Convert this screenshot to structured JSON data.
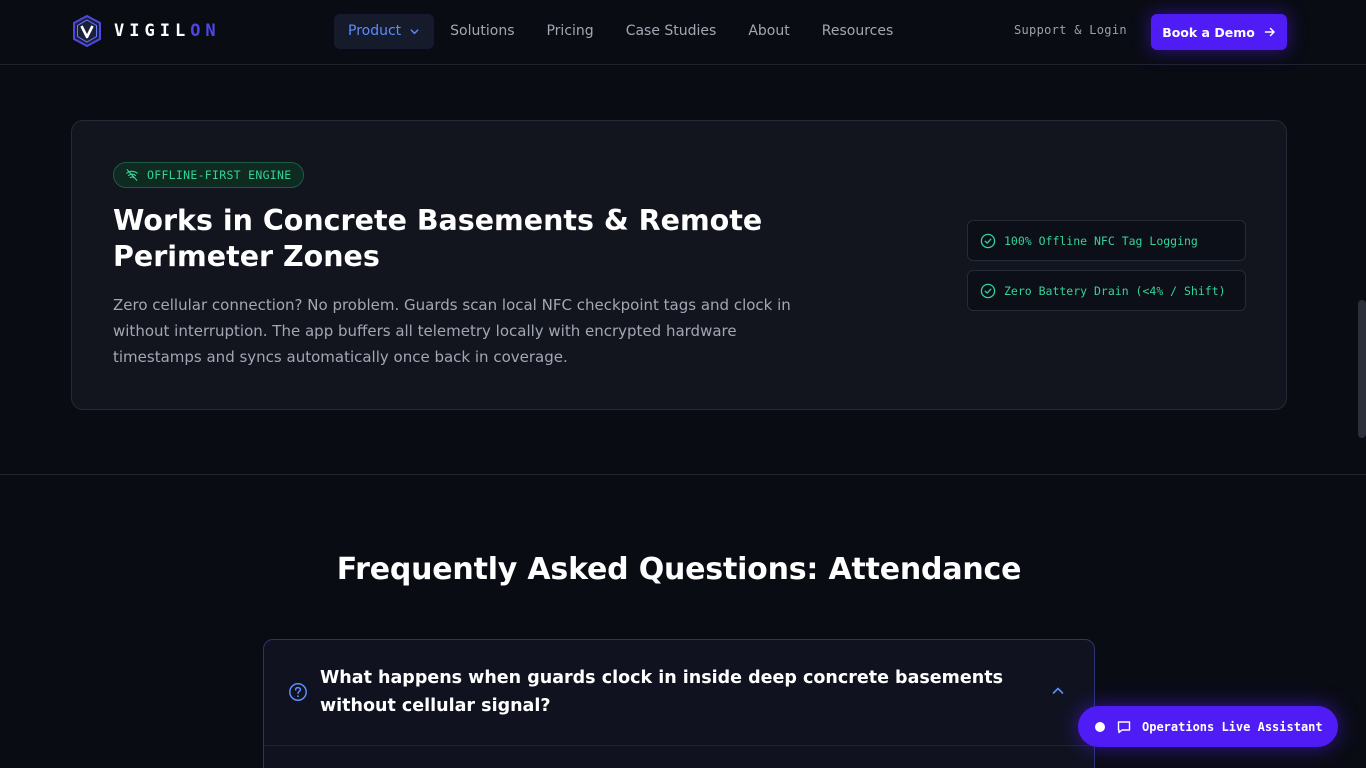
{
  "header": {
    "logo_text_main": "VIGIL",
    "logo_text_accent": "ON",
    "nav": [
      {
        "label": "Product",
        "active": true
      },
      {
        "label": "Solutions"
      },
      {
        "label": "Pricing"
      },
      {
        "label": "Case Studies"
      },
      {
        "label": "About"
      },
      {
        "label": "Resources"
      }
    ],
    "support_label": "Support & Login",
    "cta_label": "Book a Demo"
  },
  "feature": {
    "badge": "OFFLINE-FIRST ENGINE",
    "title": "Works in Concrete Basements & Remote Perimeter Zones",
    "description": "Zero cellular connection? No problem. Guards scan local NFC checkpoint tags and clock in without interruption. The app buffers all telemetry locally with encrypted hardware timestamps and syncs automatically once back in coverage.",
    "highlights": [
      "100% Offline NFC Tag Logging",
      "Zero Battery Drain (<4% / Shift)"
    ]
  },
  "faq": {
    "title": "Frequently Asked Questions: Attendance",
    "items": [
      {
        "question": "What happens when guards clock in inside deep concrete basements without cellular signal?",
        "expanded": true
      }
    ]
  },
  "assistant": {
    "label": "Operations Live Assistant"
  },
  "colors": {
    "background": "#0a0c14",
    "brand": "#4f1cf5",
    "accent_green": "#34d399",
    "nav_active": "#5b8cff"
  }
}
